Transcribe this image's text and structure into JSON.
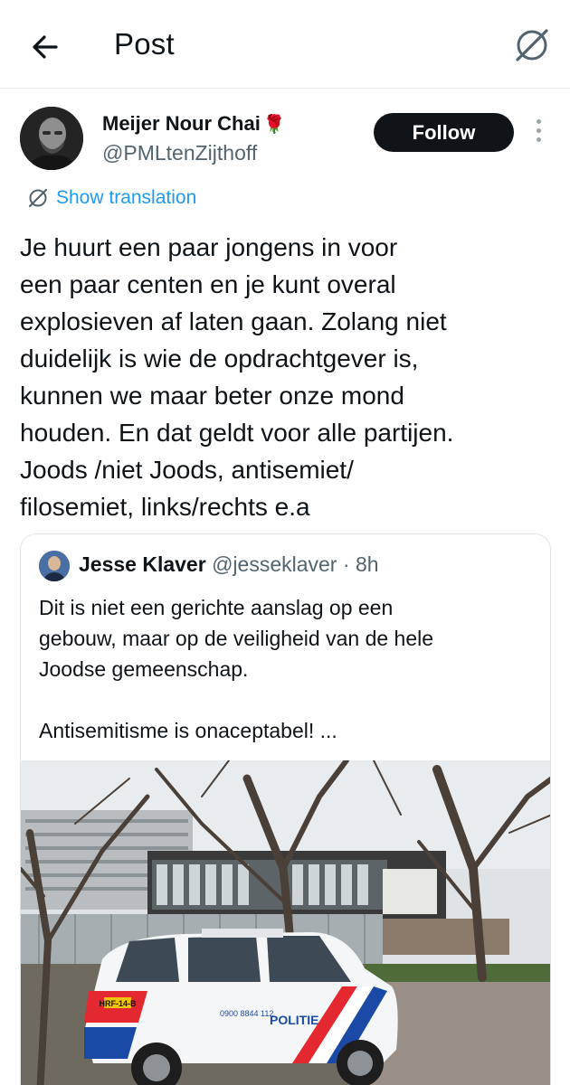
{
  "header": {
    "title": "Post",
    "back_icon": "arrow-left-icon",
    "grok_icon": "grok-icon"
  },
  "post": {
    "author_name": "Meijer Nour Chai",
    "author_emoji": "🌹",
    "author_handle": "@PMLtenZijthoff",
    "follow_label": "Follow",
    "translate_label": "Show translation",
    "text": "Je huurt een paar jongens in voor\neen paar centen en je kunt overal\nexplosieven af laten gaan. Zolang niet\nduidelijk is wie de opdrachtgever is,\nkunnen we maar beter onze mond\nhouden. En dat geldt voor alle partijen.\nJoods /niet Joods, antisemiet/\nfilosemiet, links/rechts e.a"
  },
  "quoted": {
    "author_name": "Jesse Klaver",
    "author_handle": "@jesseklaver",
    "separator": " · ",
    "time": "8h",
    "text": "Dit is niet een gerichte aanslag op een\ngebouw, maar op de veiligheid van de hele\nJoodse gemeenschap.\n\nAntisemitisme is onaceptabel! ...",
    "image_texts": {
      "police": "POLITIE",
      "emergency": "0900 8844 112",
      "plate": "HRF-14-B"
    }
  },
  "colors": {
    "link": "#1d9bf0",
    "text": "#0f1419",
    "muted": "#536471",
    "follow_bg": "#0f1419",
    "border": "#dfe5e9"
  }
}
